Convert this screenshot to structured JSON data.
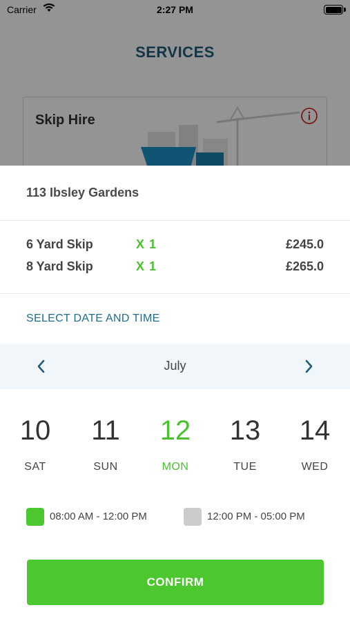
{
  "status_bar": {
    "carrier": "Carrier",
    "time": "2:27 PM"
  },
  "nav": {
    "title": "SERVICES",
    "back_icon": "arrow-left-icon",
    "close_icon": "close-icon"
  },
  "service_card": {
    "title": "Skip Hire",
    "info_icon": "info-icon"
  },
  "order": {
    "address": "113 Ibsley Gardens",
    "items": [
      {
        "name": "6 Yard Skip",
        "qty": "X 1",
        "price": "£245.0"
      },
      {
        "name": "8 Yard Skip",
        "qty": "X 1",
        "price": "£265.0"
      }
    ]
  },
  "schedule": {
    "label": "SELECT DATE AND TIME",
    "month": "July",
    "prev_icon": "chevron-left-icon",
    "next_icon": "chevron-right-icon",
    "days": [
      {
        "num": "10",
        "name": "SAT",
        "selected": false
      },
      {
        "num": "11",
        "name": "SUN",
        "selected": false
      },
      {
        "num": "12",
        "name": "MON",
        "selected": true
      },
      {
        "num": "13",
        "name": "TUE",
        "selected": false
      },
      {
        "num": "14",
        "name": "WED",
        "selected": false
      }
    ],
    "slots": [
      {
        "label": "08:00 AM - 12:00 PM",
        "selected": true
      },
      {
        "label": "12:00 PM - 05:00 PM",
        "selected": false
      }
    ]
  },
  "confirm_label": "CONFIRM",
  "colors": {
    "accent_green": "#4cc72f",
    "title_blue": "#1f5d7a",
    "link_blue": "#1e6b8c",
    "month_bar": "#f1f6fb",
    "slot_unselected": "#cccccc"
  }
}
